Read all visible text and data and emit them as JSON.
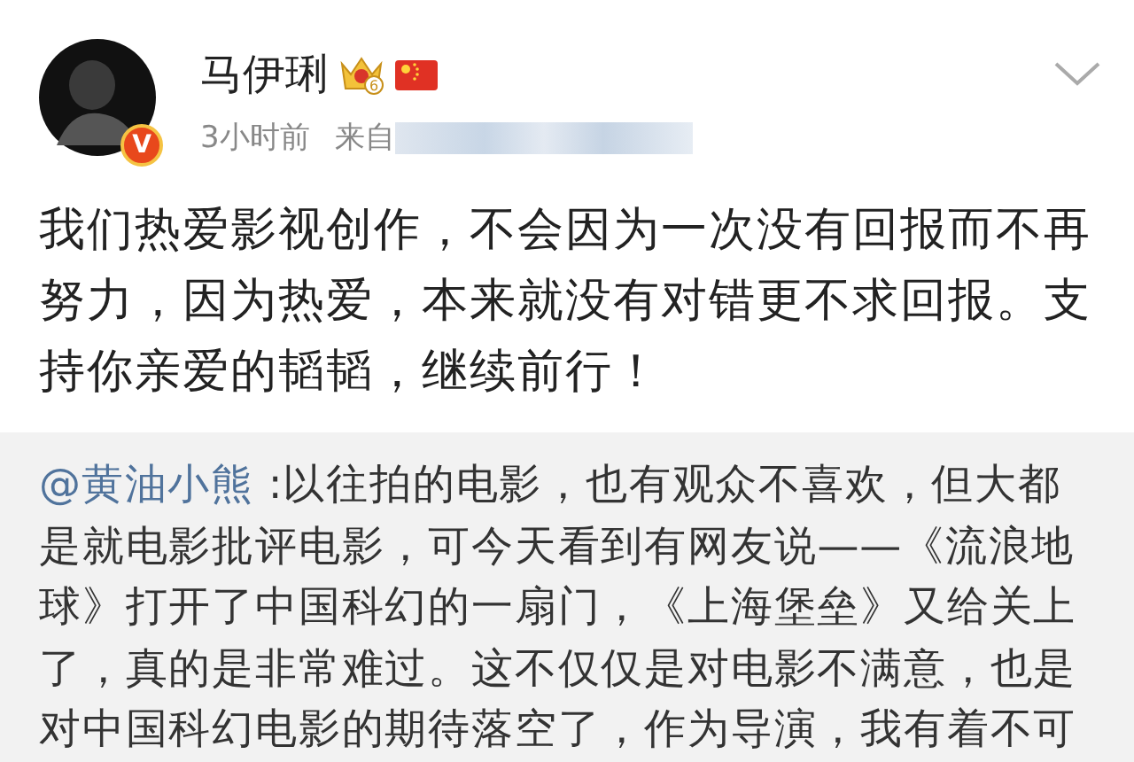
{
  "post": {
    "author": "马伊琍",
    "member_level": "6",
    "verified_badge": "V",
    "time": "3小时前",
    "source_label": "来自",
    "text": "我们热爱影视创作，不会因为一次没有回报而不再努力，因为热爱，本来就没有对错更不求回报。支持你亲爱的韬韬，继续前行！"
  },
  "quote": {
    "mention": "@黄油小熊",
    "text": " :以往拍的电影，也有观众不喜欢，但大都是就电影批评电影，可今天看到有网友说——《流浪地球》打开了中国科幻的一扇门，《上海堡垒》又给关上了，真的是非常难过。这不仅仅是对电影不满意，也是对中国科幻电影的期待落空了，作为导演，我有着不可"
  }
}
